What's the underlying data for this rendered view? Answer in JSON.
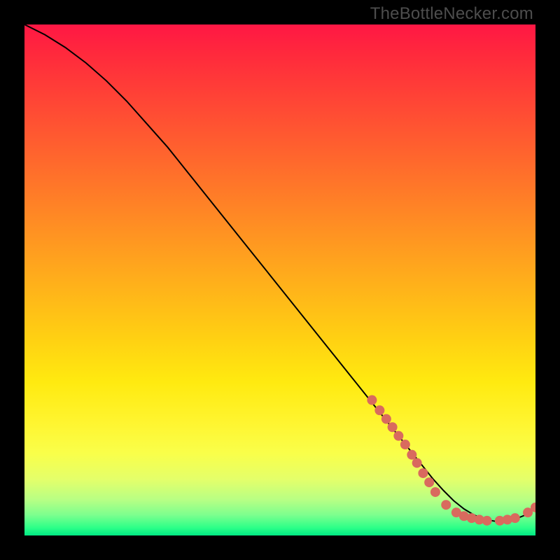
{
  "watermark": "TheBottleNecker.com",
  "chart_data": {
    "type": "line",
    "title": "",
    "xlabel": "",
    "ylabel": "",
    "xlim": [
      0,
      100
    ],
    "ylim": [
      0,
      100
    ],
    "grid": false,
    "series": [
      {
        "name": "curve",
        "color": "#000000",
        "x": [
          0,
          4,
          8,
          12,
          16,
          20,
          24,
          28,
          32,
          36,
          40,
          44,
          48,
          52,
          56,
          60,
          64,
          68,
          72,
          76,
          78,
          80,
          82,
          84,
          86,
          88,
          90,
          92,
          94,
          96,
          98,
          100
        ],
        "y": [
          100,
          98,
          95.5,
          92.5,
          89,
          85,
          80.5,
          76,
          71,
          66,
          61,
          56,
          51,
          46,
          41,
          36,
          31,
          26,
          21,
          16,
          13.5,
          11,
          8.8,
          6.8,
          5.2,
          4,
          3.2,
          2.8,
          2.8,
          3.2,
          4,
          5.5
        ]
      }
    ],
    "markers": {
      "color": "#d96a5e",
      "radius_px": 7,
      "points_xy": [
        [
          68,
          26.5
        ],
        [
          69.5,
          24.5
        ],
        [
          70.8,
          22.8
        ],
        [
          72,
          21.2
        ],
        [
          73.2,
          19.5
        ],
        [
          74.5,
          17.8
        ],
        [
          75.8,
          15.8
        ],
        [
          76.8,
          14.2
        ],
        [
          78,
          12.2
        ],
        [
          79.2,
          10.4
        ],
        [
          80.4,
          8.5
        ],
        [
          82.5,
          6.0
        ],
        [
          84.5,
          4.5
        ],
        [
          86,
          3.8
        ],
        [
          87.5,
          3.4
        ],
        [
          89,
          3.1
        ],
        [
          90.5,
          2.9
        ],
        [
          93,
          2.9
        ],
        [
          94.5,
          3.1
        ],
        [
          96,
          3.4
        ],
        [
          98.5,
          4.5
        ],
        [
          100,
          5.5
        ]
      ]
    }
  }
}
